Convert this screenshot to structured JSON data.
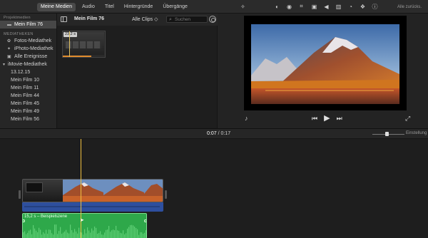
{
  "topbar": {
    "tabs": [
      {
        "label": "Meine Medien",
        "active": true
      },
      {
        "label": "Audio",
        "active": false
      },
      {
        "label": "Titel",
        "active": false
      },
      {
        "label": "Hintergründe",
        "active": false
      },
      {
        "label": "Übergänge",
        "active": false
      }
    ],
    "viewer_tools": [
      "magic-wand-icon",
      "color-balance-icon",
      "color-correction-icon",
      "crop-icon",
      "stabilization-icon",
      "volume-icon",
      "noise-reduction-icon",
      "speed-icon",
      "clip-filter-icon",
      "info-icon"
    ],
    "reset_all_label": "Alle zurücks."
  },
  "sidebar": {
    "section_projects": "Projektmedien",
    "project_item": "Mein Film 76",
    "section_libraries": "MEDIATHEKEN",
    "libraries": [
      {
        "label": "Fotos-Mediathek",
        "icon": "photos-icon"
      },
      {
        "label": "iPhoto-Mediathek",
        "icon": "iphoto-icon"
      },
      {
        "label": "Alle Ereignisse",
        "icon": "events-icon"
      }
    ],
    "imovie_library": "iMovie-Mediathek",
    "events": [
      "13.12.15",
      "Mein Film 10",
      "Mein Film 11",
      "Mein Film 44",
      "Mein Film 45",
      "Mein Film 49",
      "Mein Film 56"
    ]
  },
  "browser": {
    "event_title": "Mein Film 76",
    "filter_label": "Alle Clips ◇",
    "search_placeholder": "Suchen",
    "clip_duration": "23,2 s"
  },
  "viewer": {
    "controls": [
      "voiceover-icon",
      "skip-back-icon",
      "play-icon",
      "skip-forward-icon",
      "fullscreen-icon"
    ]
  },
  "timeline": {
    "current_time": "0:07",
    "separator": " / ",
    "total_time": "0:17",
    "settings_label": "Einstellung",
    "music_clip_label": "15,2 s – Beispielszene",
    "zoom_level": 0.4
  },
  "colors": {
    "accent_tab": "#4a4a4a",
    "music_clip": "#2ea84a",
    "detached_audio": "#2e4f9e",
    "playhead": "#f0c040"
  }
}
